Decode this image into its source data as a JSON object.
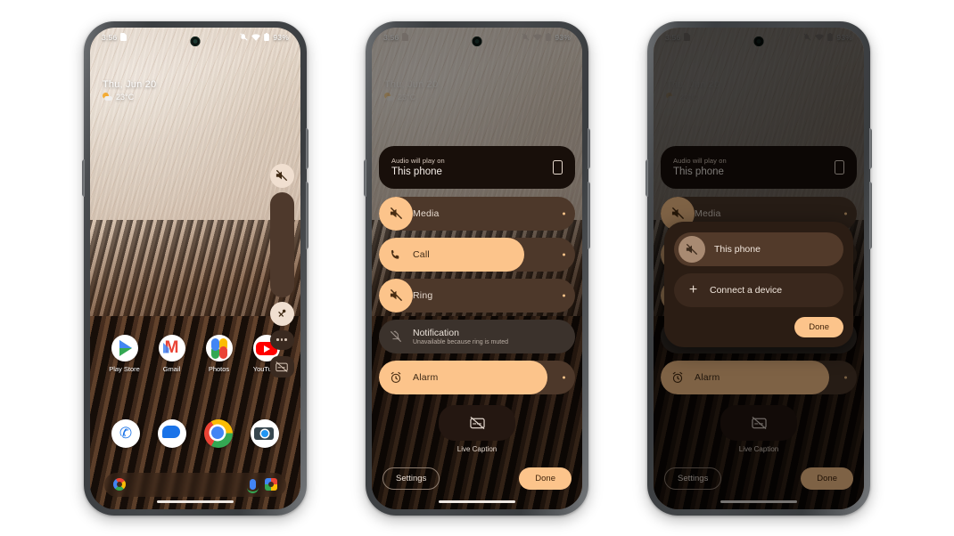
{
  "status_bar": {
    "time": "3:56",
    "sim_icon": "sim-card-icon",
    "mute_icon": "ring-muted-icon",
    "wifi_icon": "wifi-icon",
    "battery_icon": "battery-icon",
    "battery_text": "93%"
  },
  "widget": {
    "date": "Thu, Jun 20",
    "temperature": "23°C",
    "weather_icon": "partly-cloudy-icon"
  },
  "home_screen": {
    "apps": [
      {
        "label": "Play Store",
        "icon": "play-store-icon"
      },
      {
        "label": "Gmail",
        "icon": "gmail-icon"
      },
      {
        "label": "Photos",
        "icon": "google-photos-icon"
      },
      {
        "label": "YouTube",
        "icon": "youtube-icon"
      }
    ],
    "dock": [
      {
        "label": "Phone",
        "icon": "phone-icon"
      },
      {
        "label": "Messages",
        "icon": "messages-icon"
      },
      {
        "label": "Chrome",
        "icon": "chrome-icon"
      },
      {
        "label": "Camera",
        "icon": "camera-icon"
      }
    ],
    "search": {
      "google_icon": "google-g-icon",
      "mic_icon": "microphone-icon",
      "lens_icon": "google-lens-icon",
      "placeholder": ""
    }
  },
  "volume_rail": {
    "mute_icon": "volume-muted-icon",
    "vibrate_icon": "ring-vibrate-icon",
    "more_icon": "more-options-icon",
    "caption_icon": "live-caption-icon"
  },
  "volume_panel": {
    "output_card": {
      "subtitle": "Audio will play on",
      "title": "This phone",
      "icon": "phone-device-icon"
    },
    "sliders": [
      {
        "label": "Media",
        "icon": "volume-muted-icon",
        "value": 0,
        "muted": true,
        "disabled": false
      },
      {
        "label": "Call",
        "icon": "call-icon",
        "value": 74,
        "muted": false,
        "disabled": false
      },
      {
        "label": "Ring",
        "icon": "ring-muted-icon",
        "value": 0,
        "muted": true,
        "disabled": false
      },
      {
        "label": "Notification",
        "sublabel": "Unavailable because ring is muted",
        "icon": "notification-muted-icon",
        "value": 0,
        "muted": true,
        "disabled": true
      },
      {
        "label": "Alarm",
        "icon": "alarm-icon",
        "value": 86,
        "muted": false,
        "disabled": false
      }
    ],
    "live_caption": {
      "label": "Live Caption",
      "icon": "live-caption-icon"
    },
    "settings_label": "Settings",
    "done_label": "Done"
  },
  "output_picker": {
    "items": [
      {
        "label": "This phone",
        "icon": "volume-muted-icon",
        "selected": true
      },
      {
        "label": "Connect a device",
        "icon": "plus-icon",
        "selected": false
      }
    ],
    "done_label": "Done"
  },
  "colors": {
    "accent": "#fcc48b",
    "track": "#4d382a",
    "surface": "#241711",
    "on_accent": "#42250c",
    "disabled_surface": "#3b322c"
  }
}
